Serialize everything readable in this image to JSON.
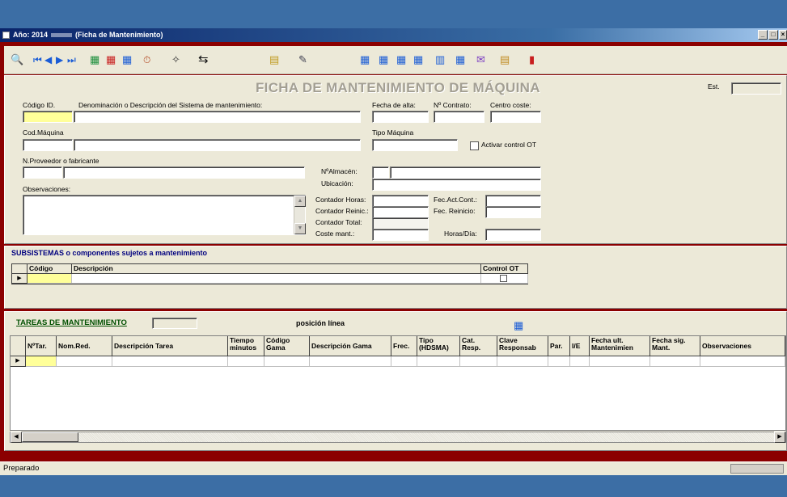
{
  "window": {
    "title_prefix": "Año: 2014",
    "title_suffix": "(Ficha de Mantenimiento)",
    "min": "_",
    "max": "□",
    "close": "×"
  },
  "toolbar": {
    "icons": [
      "search-icon",
      "first-record-icon",
      "prev-record-icon",
      "next-record-icon",
      "last-record-icon",
      "new-record-icon",
      "delete-record-icon",
      "save-record-icon",
      "timer-icon",
      "clear-icon",
      "tab-navigate-icon",
      "copy-icon",
      "report-icon",
      "action1-icon",
      "action2-icon",
      "action3-icon",
      "action4-icon",
      "calendar-pm-icon",
      "report-r-icon",
      "chart-icon",
      "folders-icon",
      "exit-icon"
    ]
  },
  "form": {
    "title": "FICHA DE MANTENIMIENTO DE MÁQUINA",
    "est_label": "Est.",
    "codigo_id_label": "Código ID.",
    "denominacion_label": "Denominación o Descripción del Sistema de mantenimiento:",
    "fecha_alta_label": "Fecha de alta:",
    "n_contrato_label": "Nº Contrato:",
    "centro_coste_label": "Centro  coste:",
    "cod_maquina_label": "Cod.Máquina",
    "tipo_maquina_label": "Tipo Máquina",
    "activar_control_label": "Activar control OT",
    "proveedor_label": "N.Proveedor o fabricante",
    "almacen_label": "NºAlmacén:",
    "ubicacion_label": "Ubicación:",
    "observaciones_label": "Observaciones:",
    "contador_horas_label": "Contador Horas:",
    "contador_reinic_label": "Contador Reinic.:",
    "contador_total_label": "Contador Total:",
    "coste_mant_label": "Coste mant.:",
    "fec_act_cont_label": "Fec.Act.Cont.:",
    "fec_reinicio_label": "Fec. Reinicio:",
    "horas_dia_label": "Horas/Día:"
  },
  "subsystems": {
    "title": "SUBSISTEMAS o componentes sujetos a mantenimiento",
    "columns": [
      "Código",
      "Descripción",
      "Control OT"
    ]
  },
  "tasks": {
    "title": "TAREAS DE MANTENIMIENTO",
    "position_label": "posición línea",
    "columns": [
      "NºTar.",
      "Nom.Red.",
      "Descripción Tarea",
      "Tiempo minutos",
      "Código Gama",
      "Descripción Gama",
      "Frec.",
      "Tipo (HDSMA)",
      "Cat. Resp.",
      "Clave Responsab",
      "Par.",
      "I/E",
      "Fecha ult. Mantenimien",
      "Fecha sig. Mant.",
      "Observaciones"
    ]
  },
  "status": {
    "text": "Preparado"
  }
}
